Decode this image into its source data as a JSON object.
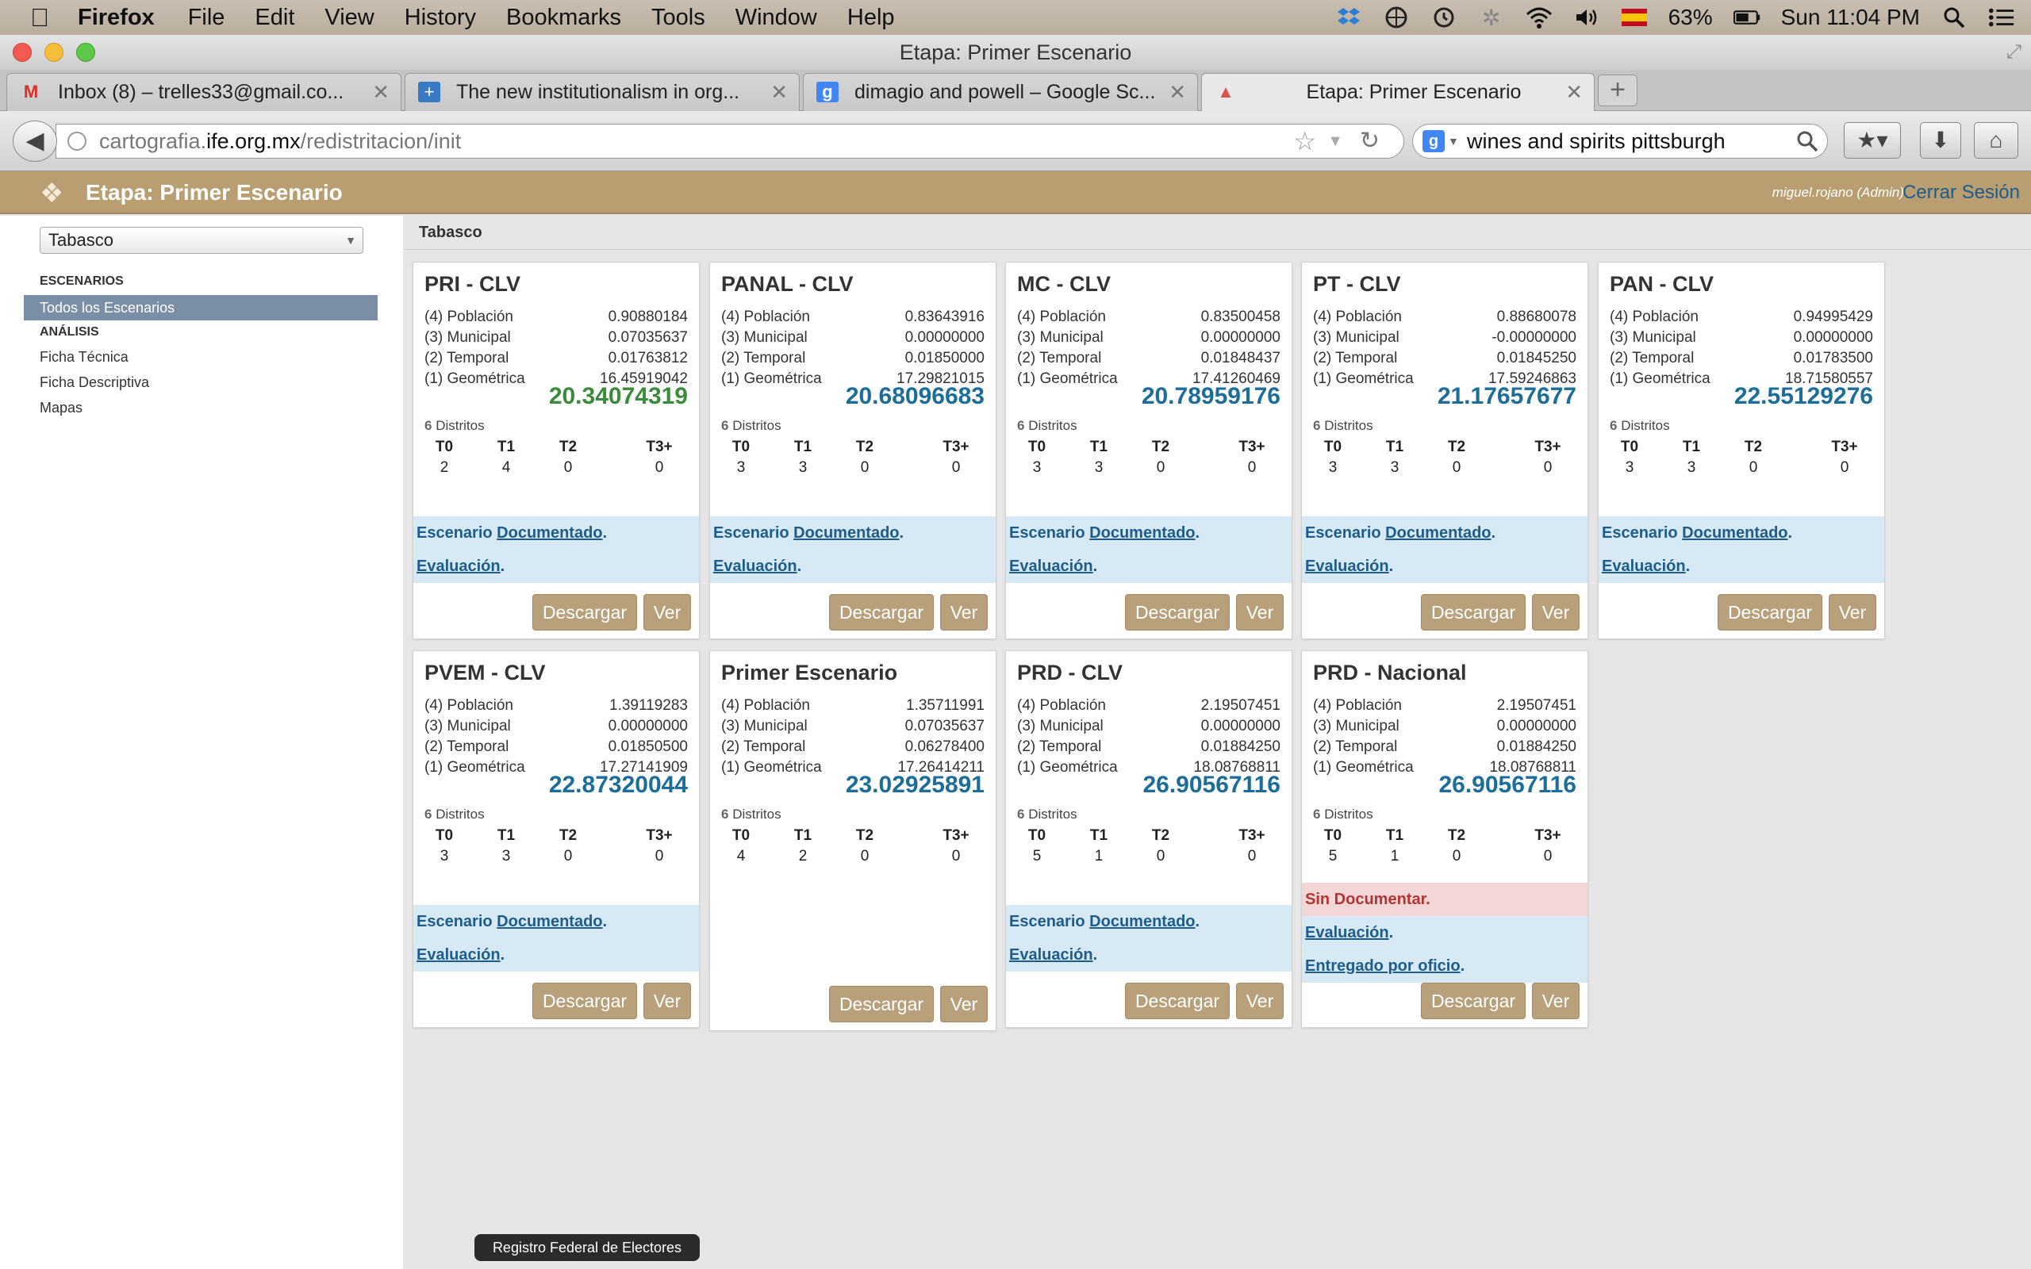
{
  "menubar": {
    "app_name": "Firefox",
    "items": [
      "File",
      "Edit",
      "View",
      "History",
      "Bookmarks",
      "Tools",
      "Window",
      "Help"
    ],
    "battery": "63%",
    "clock": "Sun 11:04 PM"
  },
  "window": {
    "title": "Etapa: Primer Escenario"
  },
  "tabs": [
    {
      "label": "Inbox (8) – trelles33@gmail.co...",
      "favicon": "M"
    },
    {
      "label": "The new institutionalism in org...",
      "favicon": "+"
    },
    {
      "label": "dimagio and powell – Google Sc...",
      "favicon": "g"
    },
    {
      "label": "Etapa: Primer Escenario",
      "favicon": "▲"
    }
  ],
  "navbar": {
    "url_prefix": "cartografia.",
    "url_domain": "ife.org.mx",
    "url_path": "/redistritacion/init",
    "search_value": "wines and spirits pittsburgh"
  },
  "app": {
    "title": "Etapa: Primer Escenario",
    "user": "miguel.rojano (Admin)",
    "logout": "Cerrar Sesión"
  },
  "sidebar": {
    "region_select": "Tabasco",
    "section_escenarios": "ESCENARIOS",
    "active_item": "Todos los Escenarios",
    "section_analisis": "ANÁLISIS",
    "items": [
      "Ficha Técnica",
      "Ficha Descriptiva",
      "Mapas"
    ]
  },
  "breadcrumb": "Tabasco",
  "labels": {
    "poblacion": "(4) Población",
    "municipal": "(3) Municipal",
    "temporal": "(2) Temporal",
    "geometrica": "(1) Geométrica",
    "distritos": "Distritos",
    "t0": "T0",
    "t1": "T1",
    "t2": "T2",
    "t3": "T3+",
    "escenario": "Escenario",
    "documentado": "Documentado",
    "evaluacion": "Evaluación",
    "sin_documentar": "Sin Documentar.",
    "entregado": "Entregado por oficio",
    "descargar": "Descargar",
    "ver": "Ver"
  },
  "cards": [
    {
      "title": "PRI - CLV",
      "poblacion": "0.90880184",
      "municipal": "0.07035637",
      "temporal": "0.01763812",
      "geometrica": "16.45919042",
      "total": "20.34074319",
      "distritos": "6",
      "t0": "2",
      "t1": "4",
      "t2": "0",
      "t3": "0"
    },
    {
      "title": "PANAL - CLV",
      "poblacion": "0.83643916",
      "municipal": "0.00000000",
      "temporal": "0.01850000",
      "geometrica": "17.29821015",
      "total": "20.68096683",
      "distritos": "6",
      "t0": "3",
      "t1": "3",
      "t2": "0",
      "t3": "0"
    },
    {
      "title": "MC - CLV",
      "poblacion": "0.83500458",
      "municipal": "0.00000000",
      "temporal": "0.01848437",
      "geometrica": "17.41260469",
      "total": "20.78959176",
      "distritos": "6",
      "t0": "3",
      "t1": "3",
      "t2": "0",
      "t3": "0"
    },
    {
      "title": "PT - CLV",
      "poblacion": "0.88680078",
      "municipal": "-0.00000000",
      "temporal": "0.01845250",
      "geometrica": "17.59246863",
      "total": "21.17657677",
      "distritos": "6",
      "t0": "3",
      "t1": "3",
      "t2": "0",
      "t3": "0"
    },
    {
      "title": "PAN - CLV",
      "poblacion": "0.94995429",
      "municipal": "0.00000000",
      "temporal": "0.01783500",
      "geometrica": "18.71580557",
      "total": "22.55129276",
      "distritos": "6",
      "t0": "3",
      "t1": "3",
      "t2": "0",
      "t3": "0"
    },
    {
      "title": "PVEM - CLV",
      "poblacion": "1.39119283",
      "municipal": "0.00000000",
      "temporal": "0.01850500",
      "geometrica": "17.27141909",
      "total": "22.87320044",
      "distritos": "6",
      "t0": "3",
      "t1": "3",
      "t2": "0",
      "t3": "0"
    },
    {
      "title": "Primer Escenario",
      "poblacion": "1.35711991",
      "municipal": "0.07035637",
      "temporal": "0.06278400",
      "geometrica": "17.26414211",
      "total": "23.02925891",
      "distritos": "6",
      "t0": "4",
      "t1": "2",
      "t2": "0",
      "t3": "0"
    },
    {
      "title": "PRD - CLV",
      "poblacion": "2.19507451",
      "municipal": "0.00000000",
      "temporal": "0.01884250",
      "geometrica": "18.08768811",
      "total": "26.90567116",
      "distritos": "6",
      "t0": "5",
      "t1": "1",
      "t2": "0",
      "t3": "0"
    },
    {
      "title": "PRD - Nacional",
      "poblacion": "2.19507451",
      "municipal": "0.00000000",
      "temporal": "0.01884250",
      "geometrica": "18.08768811",
      "total": "26.90567116",
      "distritos": "6",
      "t0": "5",
      "t1": "1",
      "t2": "0",
      "t3": "0"
    }
  ],
  "footer": "Registro Federal de Electores",
  "colors": {
    "header_bg": "#b89e70",
    "button_bg": "#b8a07a",
    "link_blue": "#1d5c8b",
    "total_blue": "#1c6d99",
    "total_green": "#3c8b3c",
    "band_blue": "#d6e9f4",
    "band_red": "#f3d6d6"
  }
}
